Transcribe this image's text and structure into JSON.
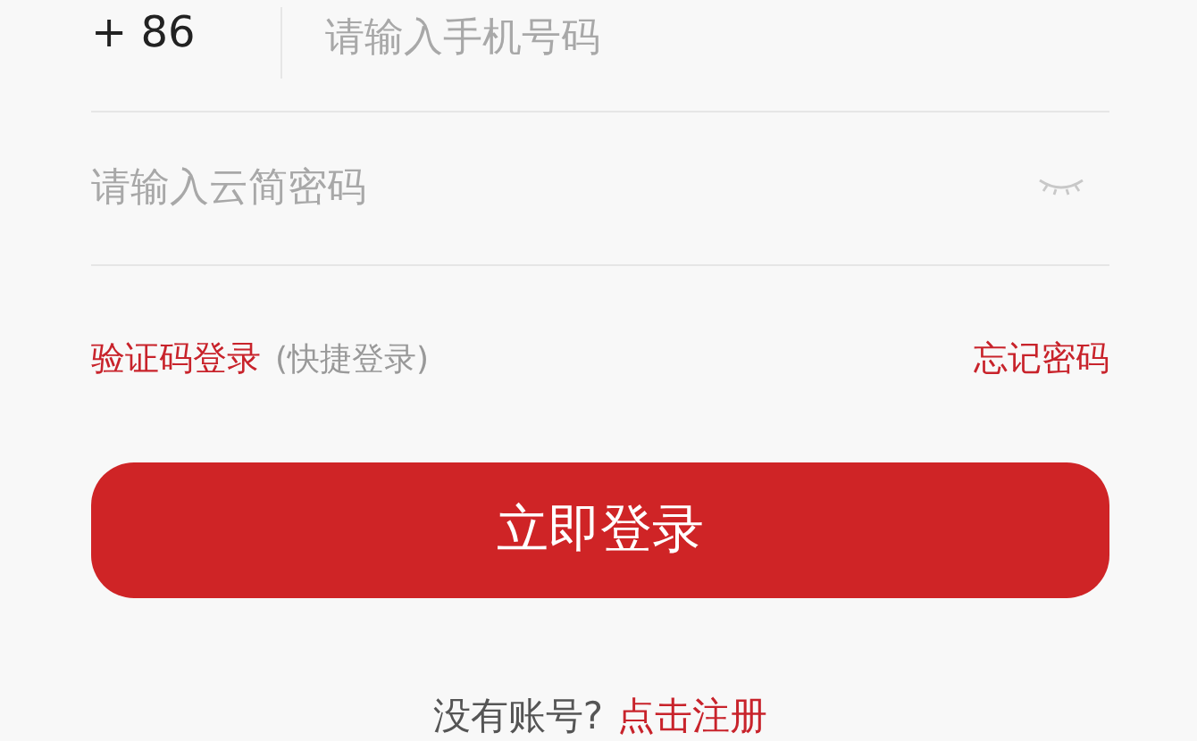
{
  "phone_field": {
    "country_code": "+ 86",
    "placeholder": "请输入手机号码"
  },
  "password_field": {
    "placeholder": "请输入云简密码",
    "password_visible": false
  },
  "sms_login": {
    "label": "验证码登录",
    "note": "(快捷登录)"
  },
  "forgot_password": "忘记密码",
  "login_button": "立即登录",
  "register_prompt": {
    "text": "没有账号?",
    "link": "点击注册"
  }
}
